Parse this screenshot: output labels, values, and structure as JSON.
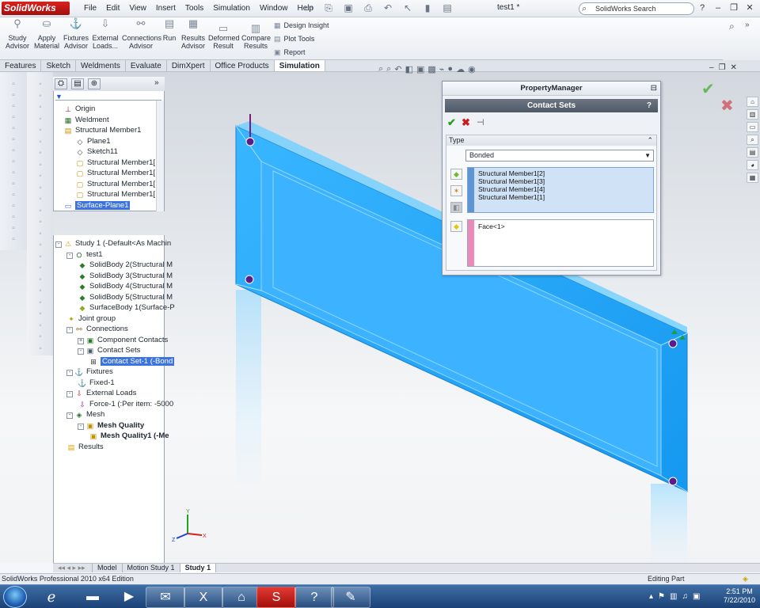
{
  "app": {
    "name": "SolidWorks",
    "doc_title": "test1 *",
    "search_placeholder": "SolidWorks Search"
  },
  "menu": [
    "File",
    "Edit",
    "View",
    "Insert",
    "Tools",
    "Simulation",
    "Window",
    "Help"
  ],
  "cmd": {
    "study_advisor": "Study Advisor",
    "apply_material": "Apply Material",
    "fixtures_advisor": "Fixtures Advisor",
    "external_loads": "External Loads...",
    "connections_advisor": "Connections Advisor",
    "run": "Run",
    "results_advisor": "Results Advisor",
    "deformed_result": "Deformed Result",
    "compare_results": "Compare Results",
    "design_insight": "Design Insight",
    "plot_tools": "Plot Tools",
    "report": "Report"
  },
  "tabs": [
    "Features",
    "Sketch",
    "Weldments",
    "Evaluate",
    "DimXpert",
    "Office Products",
    "Simulation"
  ],
  "active_tab": "Simulation",
  "feature_tree": [
    {
      "label": "Origin",
      "indent": 0
    },
    {
      "label": "Weldment",
      "indent": 0
    },
    {
      "label": "Structural Member1",
      "indent": 0
    },
    {
      "label": "Plane1",
      "indent": 1
    },
    {
      "label": "Sketch11",
      "indent": 1
    },
    {
      "label": "Structural Member1[",
      "indent": 1
    },
    {
      "label": "Structural Member1[",
      "indent": 1
    },
    {
      "label": "Structural Member1[",
      "indent": 1
    },
    {
      "label": "Structural Member1[",
      "indent": 1
    },
    {
      "label": "Surface-Plane1",
      "indent": 0
    }
  ],
  "sim_tree": [
    {
      "label": "Study 1 (-Default<As Machin",
      "indent": 0
    },
    {
      "label": "test1",
      "indent": 1
    },
    {
      "label": "SolidBody 2(Structural M",
      "indent": 2
    },
    {
      "label": "SolidBody 3(Structural M",
      "indent": 2
    },
    {
      "label": "SolidBody 4(Structural M",
      "indent": 2
    },
    {
      "label": "SolidBody 5(Structural M",
      "indent": 2
    },
    {
      "label": "SurfaceBody 1(Surface-P",
      "indent": 2
    },
    {
      "label": "Joint group",
      "indent": 1
    },
    {
      "label": "Connections",
      "indent": 1
    },
    {
      "label": "Component Contacts",
      "indent": 2
    },
    {
      "label": "Contact Sets",
      "indent": 2
    },
    {
      "label": "Contact Set-1 (-Bond",
      "indent": 3
    },
    {
      "label": "Fixtures",
      "indent": 1
    },
    {
      "label": "Fixed-1",
      "indent": 2
    },
    {
      "label": "External Loads",
      "indent": 1
    },
    {
      "label": "Force-1 (:Per item: -5000",
      "indent": 2
    },
    {
      "label": "Mesh",
      "indent": 1
    },
    {
      "label": "Mesh Quality",
      "indent": 2
    },
    {
      "label": "Mesh Quality1 (-Me",
      "indent": 3
    },
    {
      "label": "Results",
      "indent": 1
    }
  ],
  "pm": {
    "header": "PropertyManager",
    "title": "Contact Sets",
    "help": "?",
    "group": "Type",
    "type_value": "Bonded",
    "set1": [
      "Structural Member1[2]",
      "Structural Member1[3]",
      "Structural Member1[4]",
      "Structural Member1[1]"
    ],
    "set2": [
      "Face<1>"
    ]
  },
  "bottom_tabs": [
    "Model",
    "Motion Study 1",
    "Study 1"
  ],
  "status": {
    "left": "SolidWorks Professional 2010 x64 Edition",
    "right": "Editing Part"
  },
  "clock": {
    "time": "2:51 PM",
    "date": "7/22/2010"
  },
  "colors": {
    "part_blue": "#29a9ff",
    "selection_blue": "#3c73e0",
    "sw_red": "#c8201b"
  }
}
